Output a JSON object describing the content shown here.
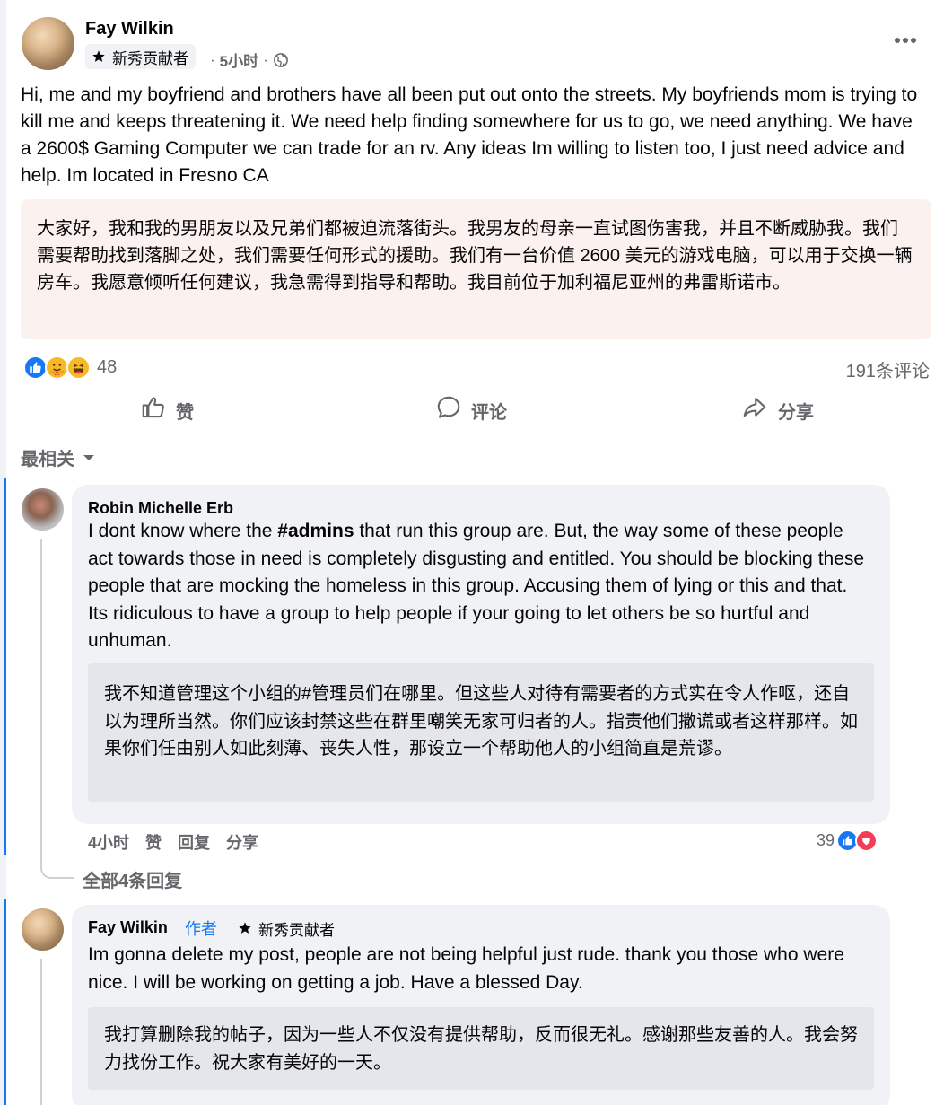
{
  "post": {
    "author": "Fay Wilkin",
    "badge": "新秀贡献者",
    "time": "5小时",
    "separator": "·",
    "text": "Hi, me and my boyfriend and brothers have all been put out onto the streets. My boyfriends mom is trying to kill me and keeps threatening it. We need help finding somewhere for us to go, we need anything. We have a 2600$ Gaming Computer we can trade for an rv. Any ideas Im willing to listen too, I just need advice and help. Im located in Fresno CA",
    "translation": "大家好，我和我的男朋友以及兄弟们都被迫流落街头。我男友的母亲一直试图伤害我，并且不断威胁我。我们需要帮助找到落脚之处，我们需要任何形式的援助。我们有一台价值 2600 美元的游戏电脑，可以用于交换一辆房车。我愿意倾听任何建议，我急需得到指导和帮助。我目前位于加利福尼亚州的弗雷斯诺市。",
    "reaction_count": "48",
    "comment_count": "191条评论"
  },
  "actions": {
    "like": "赞",
    "comment": "评论",
    "share": "分享"
  },
  "sort": {
    "label": "最相关"
  },
  "comments": [
    {
      "author": "Robin Michelle Erb",
      "text_before": "I dont know where the ",
      "hashtag": "#admins",
      "text_after": " that run this group are. But, the way some of these people act towards those in need is completely disgusting and entitled. You should be blocking these people that are mocking the homeless in this group. Accusing them of lying or this and that. Its ridiculous to have a group to help people if your going to let others be so hurtful and unhuman.",
      "translation": "我不知道管理这个小组的#管理员们在哪里。但这些人对待有需要者的方式实在令人作呕，还自以为理所当然。你们应该封禁这些在群里嘲笑无家可归者的人。指责他们撒谎或者这样那样。如果你们任由别人如此刻薄、丧失人性，那设立一个帮助他人的小组简直是荒谬。",
      "time": "4小时",
      "like": "赞",
      "reply": "回复",
      "share": "分享",
      "reaction_count": "39",
      "view_replies": "全部4条回复"
    },
    {
      "author": "Fay Wilkin",
      "author_tag": "作者",
      "badge": "新秀贡献者",
      "text": "Im gonna delete my post, people are not being helpful just rude. thank you those who were nice. I will be working on getting a job. Have a blessed Day.",
      "translation": "我打算删除我的帖子，因为一些人不仅没有提供帮助，反而很无礼。感谢那些友善的人。我会努力找份工作。祝大家有美好的一天。"
    }
  ],
  "icons": {
    "badge": "star-icon",
    "privacy": "globe-icon",
    "menu": "more-dots-icon",
    "like": "thumbs-up-icon",
    "comment": "comment-bubble-icon",
    "share": "share-arrow-icon",
    "sort": "caret-down-icon",
    "reactions": [
      "like-reaction-icon",
      "care-reaction-icon",
      "haha-reaction-icon",
      "love-reaction-icon"
    ]
  },
  "colors": {
    "accent": "#1877f2",
    "secondary_text": "#65676b",
    "bubble": "#f0f2f5",
    "translation_box": "#fbf1ef",
    "love": "#f33e58",
    "yellow": "#f7b928"
  }
}
